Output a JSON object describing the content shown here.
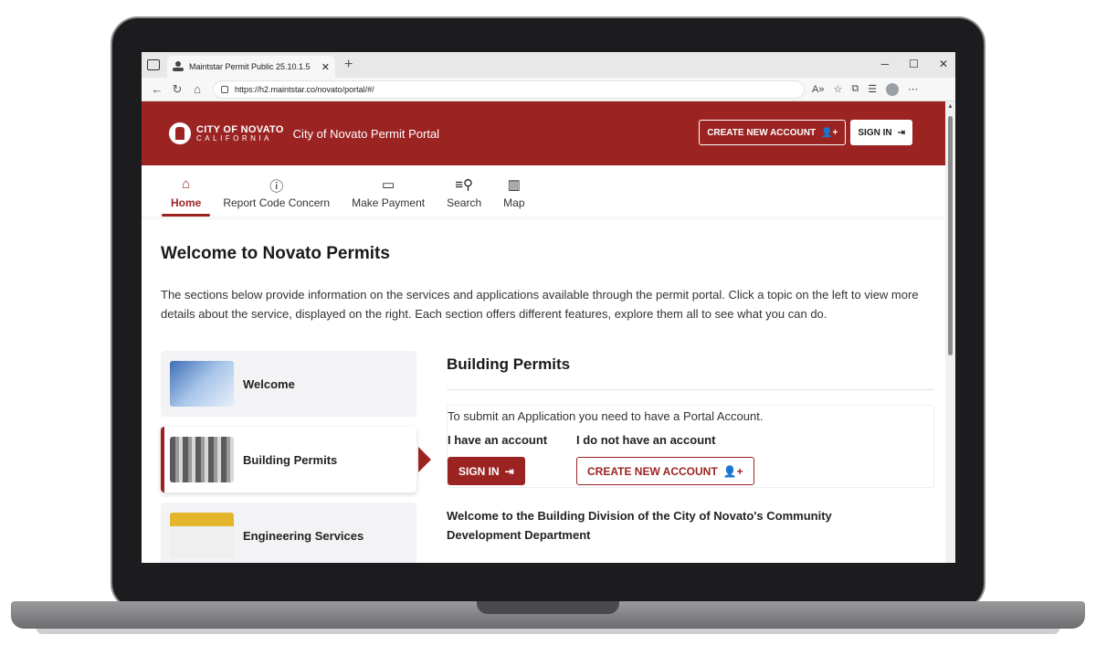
{
  "browser": {
    "tab_title": "Maintstar Permit Public 25.10.1.5",
    "url": "https://h2.maintstar.co/novato/portal/#/"
  },
  "header": {
    "logo_line1": "CITY OF NOVATO",
    "logo_line2": "CALIFORNIA",
    "portal_title": "City of Novato Permit Portal",
    "create_account_label": "CREATE NEW ACCOUNT",
    "sign_in_label": "SIGN IN"
  },
  "nav": {
    "items": [
      {
        "label": "Home",
        "icon": "home-icon",
        "active": true
      },
      {
        "label": "Report Code Concern",
        "icon": "alert-circle-icon",
        "active": false
      },
      {
        "label": "Make Payment",
        "icon": "credit-card-icon",
        "active": false
      },
      {
        "label": "Search",
        "icon": "search-list-icon",
        "active": false
      },
      {
        "label": "Map",
        "icon": "map-icon",
        "active": false
      }
    ]
  },
  "main": {
    "title": "Welcome to Novato Permits",
    "intro": "The sections below provide information on the services and applications available through the permit portal. Click a topic on the left to view more details about the service, displayed on the right. Each section offers different features, explore them all to see what you can do.",
    "cards": [
      {
        "label": "Welcome"
      },
      {
        "label": "Building Permits"
      },
      {
        "label": "Engineering Services"
      }
    ],
    "detail": {
      "title": "Building Permits",
      "account_message": "To submit an Application you need to have a Portal Account.",
      "have_account": "I have an account",
      "no_account": "I do not have an account",
      "sign_in_label": "SIGN IN",
      "create_account_label": "CREATE NEW ACCOUNT",
      "division_text": "Welcome to the Building Division of the City of Novato's Community Development Department"
    }
  },
  "colors": {
    "brand": "#9b2423"
  }
}
